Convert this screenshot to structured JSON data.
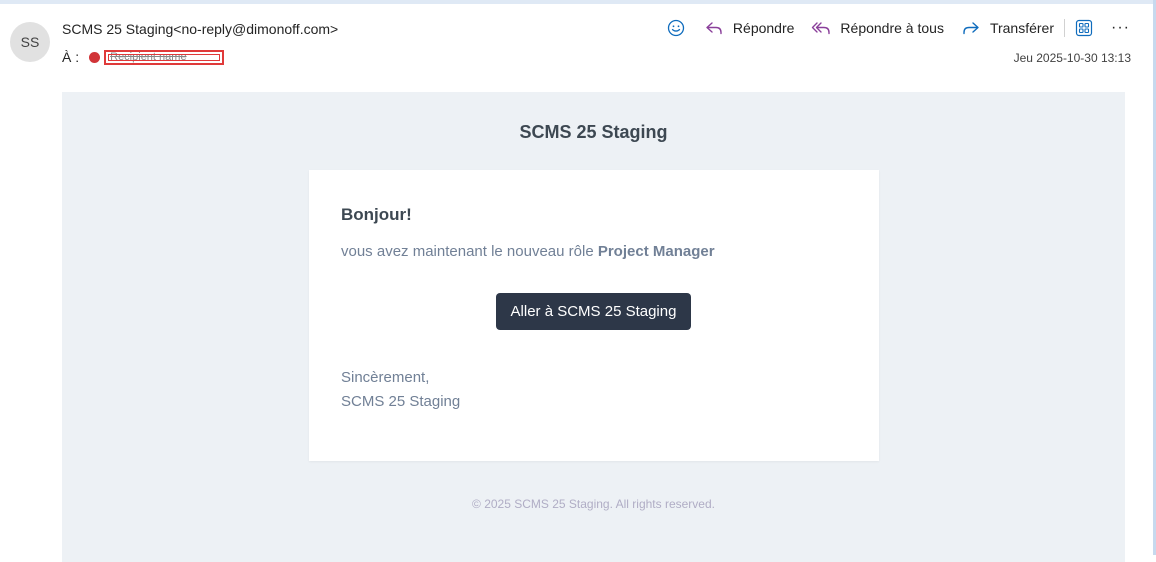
{
  "header": {
    "avatar_initials": "SS",
    "sender": "SCMS 25 Staging<no-reply@dimonoff.com>",
    "to_label": "À :",
    "to_chip_text": "Recipient name",
    "date": "Jeu 2025-10-30 13:13"
  },
  "toolbar": {
    "emoji_icon": "emoji-smile-icon",
    "reply_label": "Répondre",
    "reply_all_label": "Répondre à tous",
    "forward_label": "Transférer",
    "apps_icon": "apps-grid-icon",
    "more_label": "···"
  },
  "email": {
    "title": "SCMS 25 Staging",
    "greeting": "Bonjour!",
    "line_prefix": "vous avez maintenant le nouveau rôle ",
    "role": "Project Manager",
    "button_label": "Aller à SCMS 25 Staging",
    "signoff": "Sincèrement,",
    "signature": "SCMS 25 Staging",
    "footer": "© 2025 SCMS 25 Staging. All rights reserved."
  },
  "colors": {
    "presence_dot": "#d13438",
    "redaction_box": "#e03a3a",
    "accent_icons": "#0f6cbd",
    "reply_all_icon": "#8a3f9a",
    "email_bg": "#edf1f5",
    "button_bg": "#2d3748"
  }
}
